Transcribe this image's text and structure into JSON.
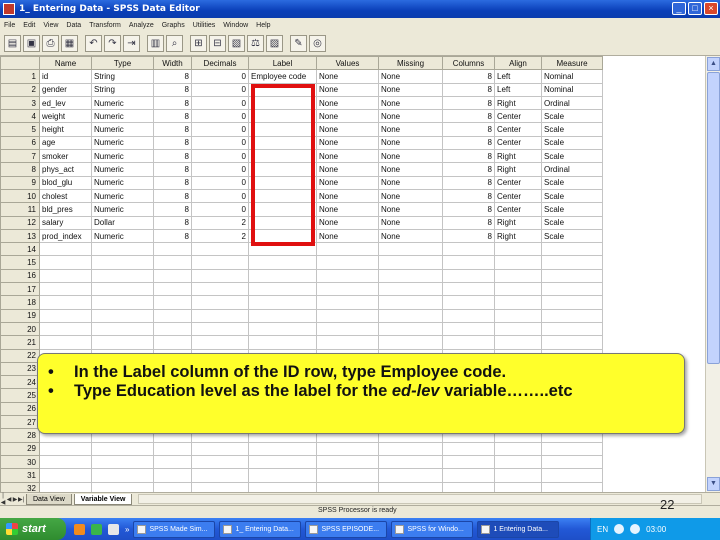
{
  "window": {
    "title": "1_ Entering Data - SPSS Data Editor"
  },
  "menu": [
    "File",
    "Edit",
    "View",
    "Data",
    "Transform",
    "Analyze",
    "Graphs",
    "Utilities",
    "Window",
    "Help"
  ],
  "grid": {
    "columns": [
      "Name",
      "Type",
      "Width",
      "Decimals",
      "Label",
      "Values",
      "Missing",
      "Columns",
      "Align",
      "Measure"
    ],
    "rows": [
      [
        "id",
        "String",
        "8",
        "0",
        "Employee code",
        "None",
        "None",
        "8",
        "Left",
        "Nominal"
      ],
      [
        "gender",
        "String",
        "8",
        "0",
        "",
        "None",
        "None",
        "8",
        "Left",
        "Nominal"
      ],
      [
        "ed_lev",
        "Numeric",
        "8",
        "0",
        "",
        "None",
        "None",
        "8",
        "Right",
        "Ordinal"
      ],
      [
        "weight",
        "Numeric",
        "8",
        "0",
        "",
        "None",
        "None",
        "8",
        "Center",
        "Scale"
      ],
      [
        "height",
        "Numeric",
        "8",
        "0",
        "",
        "None",
        "None",
        "8",
        "Center",
        "Scale"
      ],
      [
        "age",
        "Numeric",
        "8",
        "0",
        "",
        "None",
        "None",
        "8",
        "Center",
        "Scale"
      ],
      [
        "smoker",
        "Numeric",
        "8",
        "0",
        "",
        "None",
        "None",
        "8",
        "Right",
        "Scale"
      ],
      [
        "phys_act",
        "Numeric",
        "8",
        "0",
        "",
        "None",
        "None",
        "8",
        "Right",
        "Ordinal"
      ],
      [
        "blod_glu",
        "Numeric",
        "8",
        "0",
        "",
        "None",
        "None",
        "8",
        "Center",
        "Scale"
      ],
      [
        "cholest",
        "Numeric",
        "8",
        "0",
        "",
        "None",
        "None",
        "8",
        "Center",
        "Scale"
      ],
      [
        "bld_pres",
        "Numeric",
        "8",
        "0",
        "",
        "None",
        "None",
        "8",
        "Center",
        "Scale"
      ],
      [
        "salary",
        "Dollar",
        "8",
        "2",
        "",
        "None",
        "None",
        "8",
        "Right",
        "Scale"
      ],
      [
        "prod_index",
        "Numeric",
        "8",
        "2",
        "",
        "None",
        "None",
        "8",
        "Right",
        "Scale"
      ]
    ],
    "row_numbers": [
      "1",
      "2",
      "3",
      "4",
      "5",
      "6",
      "7",
      "8",
      "9",
      "10",
      "11",
      "12",
      "13",
      "14",
      "15",
      "16",
      "17",
      "18",
      "19",
      "20",
      "21",
      "22",
      "23",
      "24",
      "25",
      "26",
      "27",
      "28",
      "29",
      "30",
      "31",
      "32"
    ]
  },
  "tabs": [
    {
      "label": "Data View"
    },
    {
      "label": "Variable View",
      "active": true
    }
  ],
  "status": {
    "text": "SPSS Processor is ready"
  },
  "taskbar": {
    "start_label": "start",
    "more": "»",
    "items": [
      "SPSS Made Sim...",
      "1_ Entering Data...",
      "SPSS EPISODE...",
      "SPSS for Windo...",
      "1 Entering Data..."
    ],
    "active_index": 4,
    "lang": "EN",
    "clock": "03:00"
  },
  "callout": {
    "items": [
      {
        "bullet": "•",
        "text": "In the Label column of the ID row, type Employee code."
      },
      {
        "bullet": "•",
        "text_before": "Type Education level as the label for the ",
        "italic": "ed-lev",
        "text_after": " variable……..etc"
      }
    ]
  },
  "slide_number": "22",
  "colors": {
    "highlight": "#e01010",
    "callout_bg": "#ffff2b",
    "titlebar": "#0a3fb8"
  },
  "icons": [
    "open-icon",
    "save-icon",
    "print-icon",
    "dialog-recall-icon",
    "undo-icon",
    "redo-icon",
    "goto-case-icon",
    "variables-icon",
    "find-icon",
    "insert-cases-icon",
    "insert-variable-icon",
    "split-file-icon",
    "weight-cases-icon",
    "select-cases-icon",
    "value-labels-icon",
    "use-sets-icon"
  ]
}
